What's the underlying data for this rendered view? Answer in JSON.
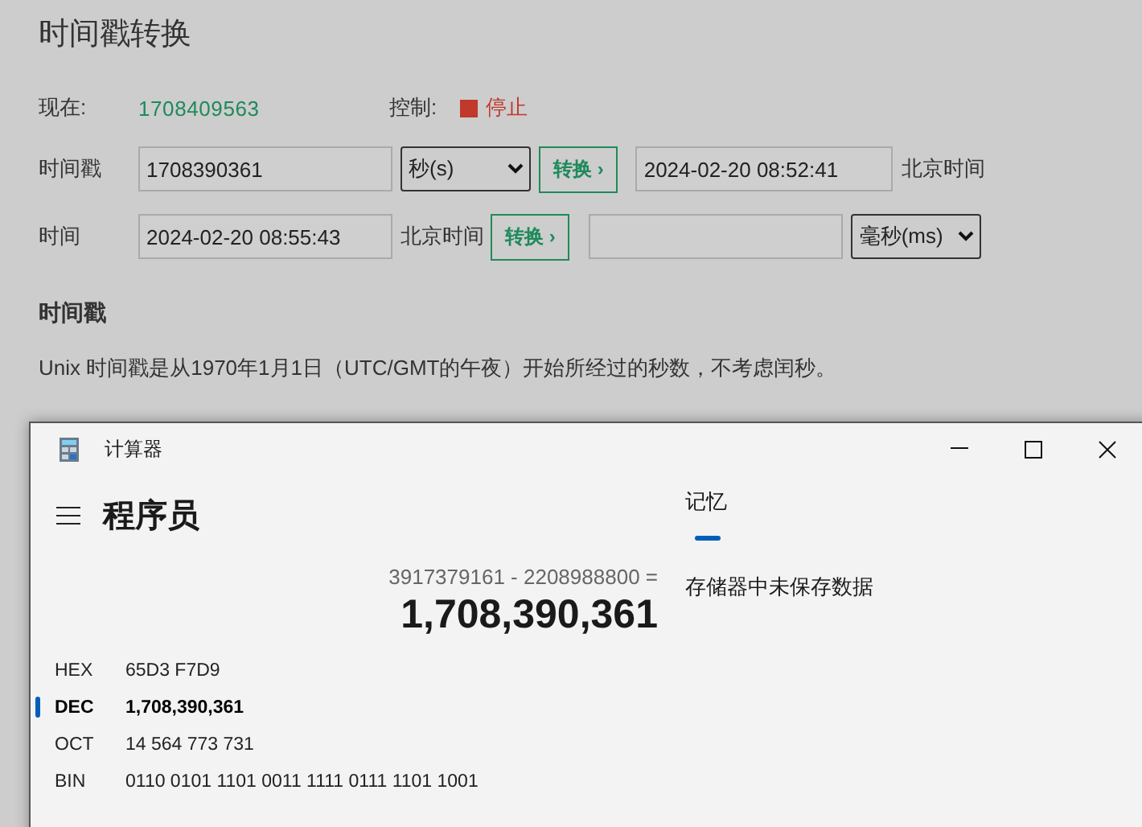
{
  "page": {
    "title": "时间戳转换",
    "now": {
      "label": "现在:",
      "value": "1708409563"
    },
    "control": {
      "label": "控制:",
      "action": "停止"
    },
    "timestamp_row": {
      "label": "时间戳",
      "input": "1708390361",
      "unit": "秒(s)",
      "button": "转换 ›",
      "result": "2024-02-20 08:52:41",
      "zone": "北京时间"
    },
    "time_row": {
      "label": "时间",
      "input": "2024-02-20 08:55:43",
      "zone": "北京时间",
      "button": "转换 ›",
      "unit": "毫秒(ms)"
    },
    "section": {
      "heading": "时间戳",
      "text": "Unix 时间戳是从1970年1月1日（UTC/GMT的午夜）开始所经过的秒数，不考虑闰秒。"
    }
  },
  "calculator": {
    "title": "计算器",
    "mode": "程序员",
    "expression": "3917379161 - 2208988800 =",
    "result": "1,708,390,361",
    "radixes": [
      {
        "name": "HEX",
        "value": "65D3 F7D9",
        "selected": false
      },
      {
        "name": "DEC",
        "value": "1,708,390,361",
        "selected": true
      },
      {
        "name": "OCT",
        "value": "14 564 773 731",
        "selected": false
      },
      {
        "name": "BIN",
        "value": "0110 0101 1101 0011 1111 0111 1101 1001",
        "selected": false
      }
    ],
    "memory": {
      "tab": "记忆",
      "empty": "存储器中未保存数据"
    }
  }
}
